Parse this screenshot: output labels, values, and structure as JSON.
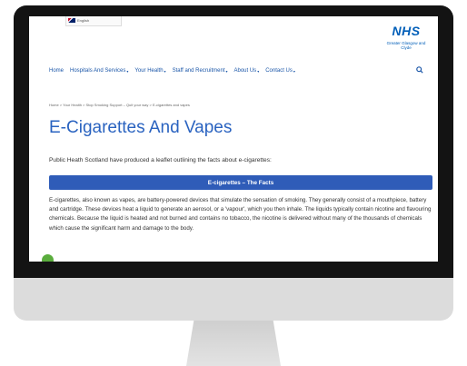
{
  "header": {
    "language_label": "English",
    "logo_text": "NHS",
    "logo_subtitle": "Greater Glasgow and Clyde"
  },
  "nav": {
    "items": [
      {
        "label": "Home",
        "has_dropdown": false
      },
      {
        "label": "Hospitals And Services",
        "has_dropdown": true
      },
      {
        "label": "Your Health",
        "has_dropdown": true
      },
      {
        "label": "Staff and Recruitment",
        "has_dropdown": true
      },
      {
        "label": "About Us",
        "has_dropdown": true
      },
      {
        "label": "Contact Us",
        "has_dropdown": true
      }
    ],
    "search_icon": "search-icon"
  },
  "breadcrumb": "Home > Your Health > Stop Smoking Support – Quit your way > E-cigarettes and vapes",
  "page": {
    "title": "E-Cigarettes And Vapes",
    "intro": "Public Heath Scotland have produced a leaflet outlining the facts about e-cigarettes:",
    "facts_button": "E-cigarettes – The Facts",
    "body": "E-cigarettes, also known as vapes, are battery-powered devices that simulate the sensation of smoking. They generally consist of a mouthpiece, battery and cartridge. These devices heat a liquid to generate an aerosol, or a 'vapour', which you then inhale. The liquids typically contain nicotine and flavouring chemicals. Because the liquid is heated and not burned and contains no tobacco, the nicotine is delivered without many of the thousands of chemicals which cause the significant harm and damage to the body."
  },
  "colors": {
    "accent": "#2f5cb8",
    "nav_link": "#1a56a8",
    "title": "#2a63c0",
    "nhs_blue": "#005eb8",
    "chat_green": "#5aad3d"
  }
}
